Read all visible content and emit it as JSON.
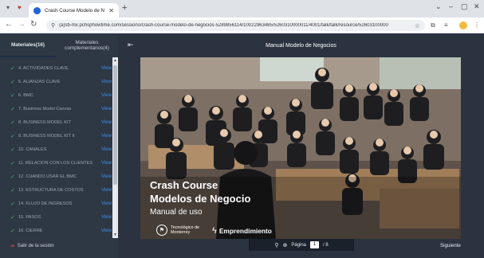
{
  "browser": {
    "tab_title": "Crash Course Modelo de Negoc",
    "tab_close": "✕",
    "new_tab": "+",
    "window_controls": [
      "⌄",
      "–",
      "▢",
      "✕"
    ],
    "url": "(a)sb-mx.pchsphowtime.com/sessions/crash-course-modelo-de-negocios-5289856114/10022963485/5260310000011/4001/talk/talk/resource/52603100000",
    "icons": [
      "back-icon",
      "forward-icon",
      "reload-icon",
      "site-info-icon",
      "bookmark-star-icon",
      "extensions-icon",
      "profile-icon",
      "menu-icon"
    ]
  },
  "sidebar": {
    "tabs": [
      {
        "label": "Materiales(16)"
      },
      {
        "label": "Materiales complementarios(4)"
      }
    ],
    "items": [
      {
        "label": "4. ACTIVIDADES CLAVE",
        "action": "View"
      },
      {
        "label": "5. ALIANZAS CLAVE",
        "action": "View"
      },
      {
        "label": "6. BMC",
        "action": "View"
      },
      {
        "label": "7. Business Model Canvas",
        "action": "View"
      },
      {
        "label": "8. BUSINESS MODEL KIT",
        "action": "View"
      },
      {
        "label": "9. BUSINESS MODEL KIT II",
        "action": "View"
      },
      {
        "label": "10. CANALES",
        "action": "View"
      },
      {
        "label": "11. RELACIÓN CON LOS CLIENTES",
        "action": "View"
      },
      {
        "label": "12. CUANDO USAR EL BMC",
        "action": "View"
      },
      {
        "label": "13. ESTRUCTURA DE COSTOS",
        "action": "View"
      },
      {
        "label": "14. FLUJO DE INGRESOS",
        "action": "View"
      },
      {
        "label": "15. PASOS",
        "action": "View"
      },
      {
        "label": "16. CIERRE",
        "action": "View"
      }
    ],
    "logout_label": "Salir de la sesión",
    "check_color": "#3cbf6d",
    "link_color": "#3e8ee8"
  },
  "header": {
    "title": "Manual Modelo de Negocios"
  },
  "cover": {
    "title_line1": "Crash Course",
    "title_line2": "Modelos de Negocio",
    "subtitle": "Manual de uso",
    "logo1_text": "Tecnológico de Monterrey",
    "logo2_text": "Emprendimiento"
  },
  "pager": {
    "label": "Página",
    "current": "1",
    "total": "/ 8"
  },
  "next_label": "Siguiente"
}
